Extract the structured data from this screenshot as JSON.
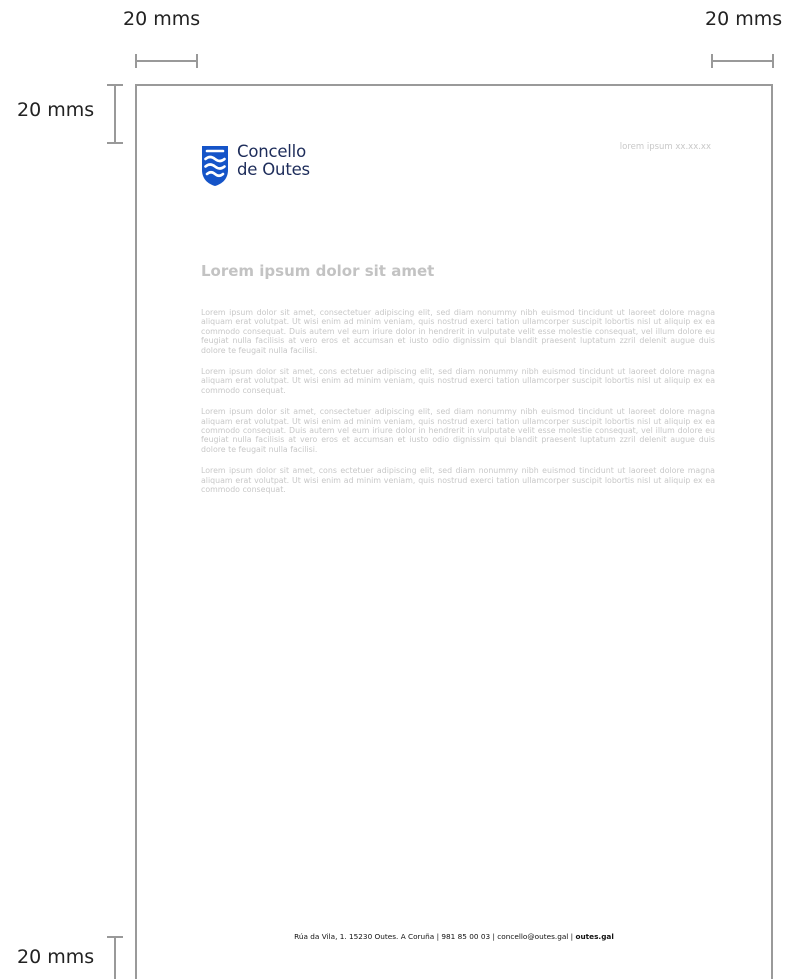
{
  "dimensions": {
    "top_left": "20 mms",
    "top_right": "20 mms",
    "left": "20 mms",
    "bottom": "20 mms"
  },
  "logo": {
    "line1": "Concello",
    "line2": "de Outes",
    "shield_color": "#1554c8"
  },
  "header": {
    "reference": "lorem ipsum xx.xx.xx"
  },
  "letter": {
    "title": "Lorem ipsum dolor sit amet",
    "paragraphs": [
      "Lorem ipsum dolor sit amet, consectetuer adipiscing elit, sed diam nonummy nibh euismod tincidunt ut laoreet dolore magna aliquam erat volutpat. Ut wisi enim ad minim veniam, quis nostrud exerci tation ullamcorper suscipit lobortis nisl ut aliquip ex ea commodo consequat. Duis autem vel eum iriure dolor in hendrerit in vulputate velit esse molestie consequat, vel illum dolore eu feugiat nulla facilisis at vero eros et accumsan et iusto odio dignissim qui blandit praesent luptatum zzril delenit augue duis dolore te feugait nulla facilisi.",
      "Lorem ipsum dolor sit amet, cons ectetuer adipiscing elit, sed diam nonummy nibh euismod tincidunt ut laoreet dolore magna aliquam erat volutpat. Ut wisi enim ad minim veniam, quis nostrud exerci tation ullamcorper suscipit lobortis nisl ut aliquip ex ea commodo consequat.",
      "Lorem ipsum dolor sit amet, consectetuer adipiscing elit, sed diam nonummy nibh euismod tincidunt ut laoreet dolore magna aliquam erat volutpat. Ut wisi enim ad minim veniam, quis nostrud exerci tation ullamcorper suscipit lobortis nisl ut aliquip ex ea commodo consequat. Duis autem vel eum iriure dolor in hendrerit in vulputate velit esse molestie consequat, vel illum dolore eu feugiat nulla facilisis at vero eros et accumsan et iusto odio dignissim qui blandit praesent luptatum zzril delenit augue duis dolore te feugait nulla facilisi.",
      "Lorem ipsum dolor sit amet, cons ectetuer adipiscing elit, sed diam nonummy nibh euismod tincidunt ut laoreet dolore magna aliquam erat volutpat. Ut wisi enim ad minim veniam, quis nostrud exerci tation ullamcorper suscipit lobortis nisl ut aliquip ex ea commodo consequat."
    ]
  },
  "footer": {
    "address": "Rúa da Vila, 1. 15230 Outes. A Coruña | 981 85 00 03 | concello@outes.gal | ",
    "website": "outes.gal"
  }
}
